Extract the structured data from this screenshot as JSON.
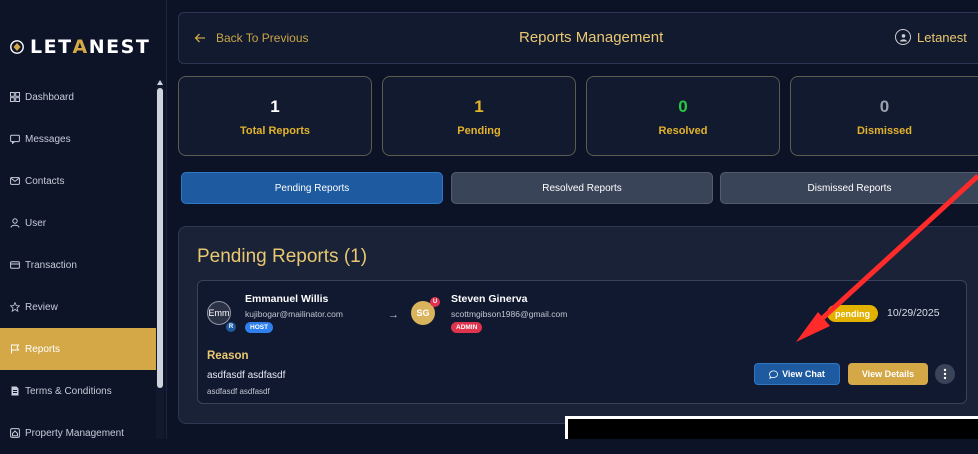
{
  "brand": {
    "part1": "LET",
    "part2": "A",
    "part3": "NEST"
  },
  "colors": {
    "accent": "#d4a847",
    "primary": "#1d5aa0",
    "background": "#0c1326",
    "annotation": "#ff2a2a"
  },
  "sidebar": {
    "items": [
      {
        "label": "Dashboard",
        "icon": "dashboard-icon"
      },
      {
        "label": "Messages",
        "icon": "message-icon"
      },
      {
        "label": "Contacts",
        "icon": "mail-icon"
      },
      {
        "label": "User",
        "icon": "user-icon"
      },
      {
        "label": "Transaction",
        "icon": "card-icon"
      },
      {
        "label": "Review",
        "icon": "star-icon"
      },
      {
        "label": "Reports",
        "icon": "flag-icon",
        "active": true
      },
      {
        "label": "Terms & Conditions",
        "icon": "document-icon"
      },
      {
        "label": "Property Management",
        "icon": "home-icon"
      }
    ]
  },
  "header": {
    "back_label": "Back To Previous",
    "title": "Reports Management",
    "user_name": "Letanest"
  },
  "stats": [
    {
      "value": "1",
      "label": "Total Reports",
      "color": "#ffffff"
    },
    {
      "value": "1",
      "label": "Pending",
      "color": "#e3b32a"
    },
    {
      "value": "0",
      "label": "Resolved",
      "color": "#28c840"
    },
    {
      "value": "0",
      "label": "Dismissed",
      "color": "#9aa1af"
    }
  ],
  "tabs": [
    {
      "label": "Pending Reports",
      "active": true
    },
    {
      "label": "Resolved Reports",
      "active": false
    },
    {
      "label": "Dismissed Reports",
      "active": false
    }
  ],
  "pending": {
    "title": "Pending Reports (1)",
    "report": {
      "reporter": {
        "name": "Emmanuel Willis",
        "email": "kujibogar@mailinator.com",
        "role": "HOST",
        "avatar_text": "Emm",
        "badge": "R"
      },
      "reported": {
        "name": "Steven Ginerva",
        "email": "scottmgibson1986@gmail.com",
        "role": "ADMIN",
        "initials": "SG",
        "badge": "U"
      },
      "status": "pending",
      "date": "10/29/2025",
      "reason_heading": "Reason",
      "reason_text": "asdfasdf asdfasdf",
      "reason_sub": "asdfasdf asdfasdf",
      "view_chat_label": "View Chat",
      "view_details_label": "View Details"
    }
  }
}
